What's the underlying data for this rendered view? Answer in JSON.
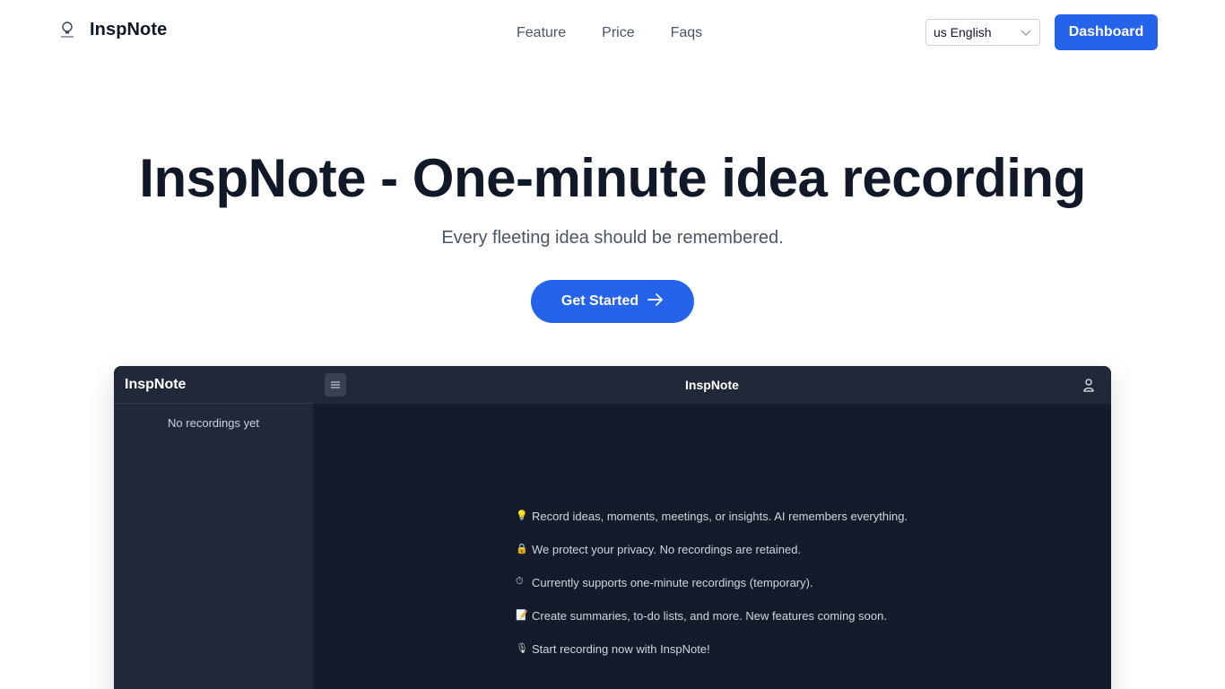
{
  "header": {
    "brand": "InspNote",
    "nav": [
      "Feature",
      "Price",
      "Faqs"
    ],
    "language": "us English",
    "dashboard_label": "Dashboard"
  },
  "hero": {
    "title": "InspNote - One-minute idea recording",
    "subtitle": "Every fleeting idea should be remembered.",
    "cta_label": "Get Started"
  },
  "preview": {
    "sidebar_title": "InspNote",
    "empty_text": "No recordings yet",
    "topbar_title": "InspNote",
    "items": [
      {
        "emoji": "💡",
        "text": "Record ideas, moments, meetings, or insights. AI remembers everything."
      },
      {
        "emoji": "🔒",
        "text": "We protect your privacy. No recordings are retained."
      },
      {
        "emoji": "⏱",
        "text": "Currently supports one-minute recordings (temporary)."
      },
      {
        "emoji": "📝",
        "text": "Create summaries, to-do lists, and more. New features coming soon."
      },
      {
        "emoji": "🎙",
        "text": "Start recording now with InspNote!"
      }
    ]
  },
  "colors": {
    "accent": "#2563eb",
    "text_dark": "#111827",
    "text_muted": "#4b5563",
    "app_bg": "#151b2b",
    "app_panel": "#222838"
  },
  "icons": {
    "brand": "lightbulb-icon",
    "select": "chevron-down-icon",
    "cta": "arrow-right-icon",
    "menu": "hamburger-icon",
    "user": "user-icon"
  }
}
